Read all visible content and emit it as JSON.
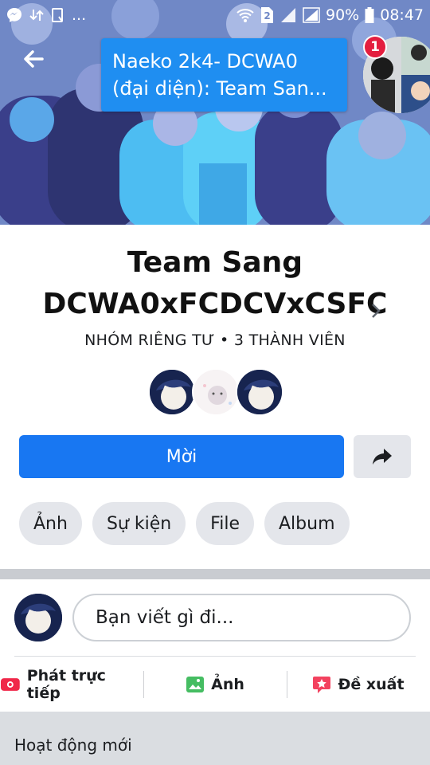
{
  "status_bar": {
    "left_icons": [
      "messenger-icon",
      "data-transfer-icon",
      "clipboard-icon",
      "more-dots-icon"
    ],
    "more_text": "...",
    "sim_label": "2",
    "battery": "90%",
    "time": "08:47"
  },
  "chat_head": {
    "message_line1": "Naeko 2k4- DCWA0",
    "message_line2": "(đại diện): Team San...",
    "badge_count": "1"
  },
  "group": {
    "title_line1": "Team Sang",
    "title_line2": "DCWA0xFCDCVxCSFC",
    "meta": "NHÓM RIÊNG TƯ • 3 THÀNH VIÊN",
    "member_count": 3
  },
  "buttons": {
    "invite": "Mời",
    "share_icon": "share-arrow-icon"
  },
  "chips": [
    {
      "label": "Ảnh"
    },
    {
      "label": "Sự kiện"
    },
    {
      "label": "File"
    },
    {
      "label": "Album"
    }
  ],
  "composer": {
    "placeholder": "Bạn viết gì đi..."
  },
  "actions": [
    {
      "label": "Phát trực tiếp",
      "icon": "live-video-icon",
      "color": "#f02849"
    },
    {
      "label": "Ảnh",
      "icon": "photo-icon",
      "color": "#45bd62"
    },
    {
      "label": "Đề xuất",
      "icon": "recommend-icon",
      "color": "#f3425f"
    }
  ],
  "section": {
    "recent_activity": "Hoạt động mới"
  },
  "colors": {
    "primary": "#1877f2",
    "chat_bubble": "#1f8ef1",
    "cover": "#6f86c4",
    "chip_bg": "#e4e6eb"
  }
}
